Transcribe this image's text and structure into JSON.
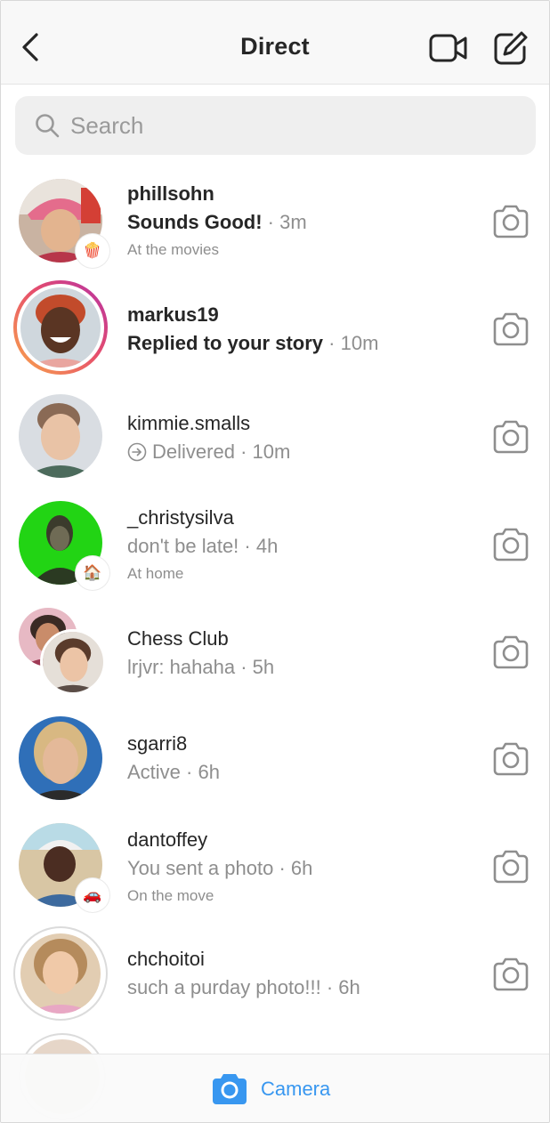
{
  "header": {
    "title": "Direct"
  },
  "search": {
    "placeholder": "Search",
    "value": ""
  },
  "threads": [
    {
      "username": "phillsohn",
      "message": "Sounds Good!",
      "time": "3m",
      "status": "At the movies",
      "badge": "🍿",
      "unread": true
    },
    {
      "username": "markus19",
      "message": "Replied to your story",
      "time": "10m",
      "status": "",
      "unread": true,
      "story_ring": true
    },
    {
      "username": "kimmie.smalls",
      "message": "Delivered",
      "time": "10m",
      "status": "",
      "unread": false,
      "delivered": true
    },
    {
      "username": "_christysilva",
      "message": "don't be late!",
      "time": "4h",
      "status": "At home",
      "badge": "🏠",
      "unread": false
    },
    {
      "username": "Chess Club",
      "message": "lrjvr: hahaha",
      "time": "5h",
      "status": "",
      "unread": false,
      "group": true
    },
    {
      "username": "sgarri8",
      "message": "Active",
      "time": "6h",
      "status": "",
      "unread": false
    },
    {
      "username": "dantoffey",
      "message": "You sent a photo",
      "time": "6h",
      "status": "On the move",
      "badge": "🚗",
      "unread": false
    },
    {
      "username": "chchoitoi",
      "message": "such a purday photo!!!",
      "time": "6h",
      "status": "",
      "unread": false,
      "seen_ring": true
    }
  ],
  "separator": "·",
  "bottom_bar": {
    "camera_label": "Camera"
  },
  "colors": {
    "accent": "#3897f0",
    "text": "#262626",
    "secondary": "#8e8e8e",
    "story_ring_start": "#f9a84a",
    "story_ring_end": "#c13584"
  }
}
